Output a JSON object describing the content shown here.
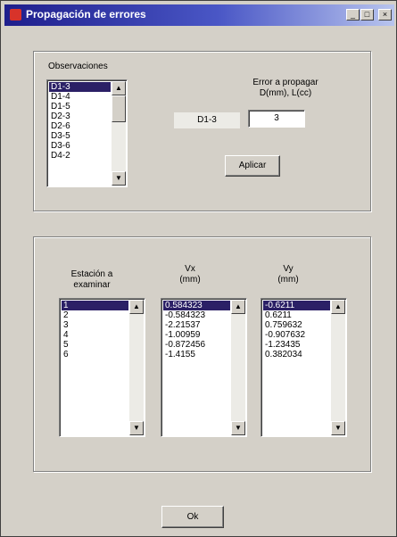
{
  "window": {
    "title": "Propagación de errores"
  },
  "observations": {
    "label": "Observaciones",
    "items": [
      "D1-3",
      "D1-4",
      "D1-5",
      "D2-3",
      "D2-6",
      "D3-5",
      "D3-6",
      "D4-2"
    ],
    "selected_index": 0
  },
  "error": {
    "label_line1": "Error a propagar",
    "label_line2": "D(mm), L(cc)",
    "current_obs": "D1-3",
    "value": "3",
    "apply_label": "Aplicar"
  },
  "station": {
    "label_line1": "Estación a",
    "label_line2": "examinar",
    "items": [
      "1",
      "2",
      "3",
      "4",
      "5",
      "6"
    ],
    "selected_index": 0
  },
  "vx": {
    "label_line1": "Vx",
    "label_line2": "(mm)",
    "items": [
      "0.584323",
      "-0.584323",
      "-2.21537",
      "-1.00959",
      "-0.872456",
      "-1.4155"
    ],
    "selected_index": 0
  },
  "vy": {
    "label_line1": "Vy",
    "label_line2": "(mm)",
    "items": [
      "-0.6211",
      "0.6211",
      "0.759632",
      "-0.907632",
      "-1.23435",
      "0.382034"
    ],
    "selected_index": 0
  },
  "ok_label": "Ok"
}
